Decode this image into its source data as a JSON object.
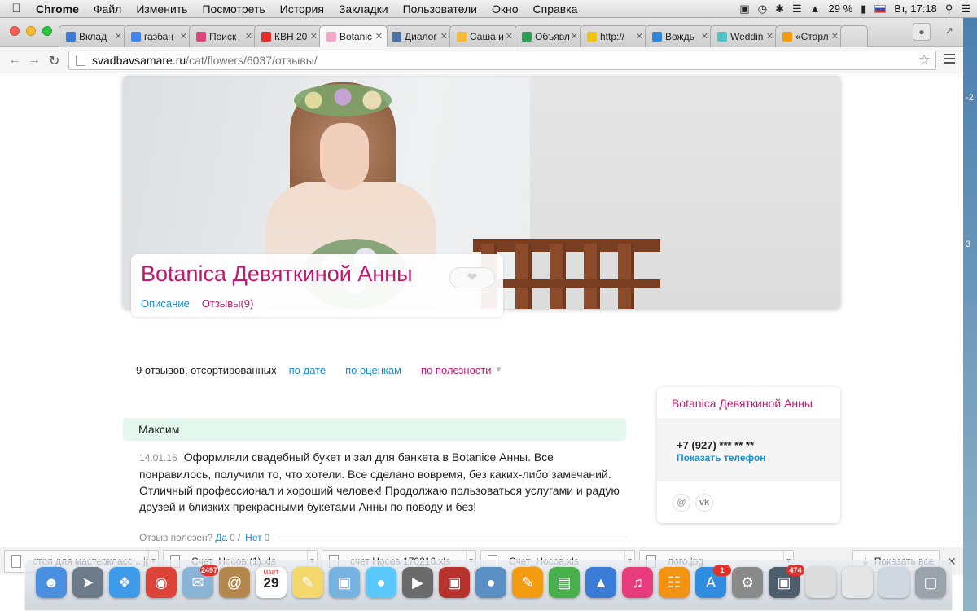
{
  "menubar": {
    "app_name": "Chrome",
    "items": [
      "Файл",
      "Изменить",
      "Посмотреть",
      "История",
      "Закладки",
      "Пользователи",
      "Окно",
      "Справка"
    ],
    "battery": "29 %",
    "clock": "Вт, 17:18"
  },
  "tabs": [
    {
      "title": "Вклад",
      "color": "#3b7bd6",
      "active": false
    },
    {
      "title": "газбан",
      "color": "#4285f4",
      "active": false
    },
    {
      "title": "Поиск",
      "color": "#e0447a",
      "active": false
    },
    {
      "title": "КВН 20",
      "color": "#e52d27",
      "active": false
    },
    {
      "title": "Botanic",
      "color": "#f3a6c8",
      "active": true
    },
    {
      "title": "Диалог",
      "color": "#4c75a3",
      "active": false
    },
    {
      "title": "Саша и",
      "color": "#f6b93b",
      "active": false
    },
    {
      "title": "Объявл",
      "color": "#2e9e57",
      "active": false
    },
    {
      "title": "http://",
      "color": "#f1c40f",
      "active": false
    },
    {
      "title": "Вождь",
      "color": "#2e86de",
      "active": false
    },
    {
      "title": "Weddin",
      "color": "#4fc3c7",
      "active": false
    },
    {
      "title": "«Старл",
      "color": "#f39c12",
      "active": false
    }
  ],
  "address": {
    "host": "svadbavsamare.ru",
    "path": "/cat/flowers/6037/отзывы/"
  },
  "profile": {
    "title": "Botanica Девяткиной Анны",
    "tab_description": "Описание",
    "tab_reviews": "Отзывы(9)"
  },
  "sort": {
    "summary": "9 отзывов, отсортированных",
    "by_date": "по дате",
    "by_rating": "по оценкам",
    "by_usefulness": "по полезности"
  },
  "review": {
    "author": "Максим",
    "date": "14.01.16",
    "text": "Оформляли свадебный букет и зал для банкета в Botanice Анны. Все понравилось, получили то, что хотели. Все сделано вовремя, без каких-либо замечаний. Отличный профессионал и хороший человек! Продолжаю пользоваться услугами и радую друзей и близких прекрасными букетами Анны по поводу и без!",
    "useful_label": "Отзыв полезен?",
    "yes_label": "Да",
    "yes_count": "0",
    "separator": "/",
    "no_label": "Нет",
    "no_count": "0"
  },
  "sidebar": {
    "title": "Botanica Девяткиной Анны",
    "phone": "+7 (927) *** ** **",
    "show_phone": "Показать телефон",
    "email_icon": "@",
    "vk_icon": "vk"
  },
  "downloads": {
    "items": [
      "стол для мастеркласс....jpg",
      "Счет_Носов (1).xls",
      "счет Носов 170216.xls",
      "Счет_Носов.xls",
      "лого.jpg"
    ],
    "show_all": "Показать все"
  },
  "dock": {
    "badges": {
      "mail": "2497",
      "appstore": "1",
      "app": "474"
    },
    "calendar_month": "МАРТ",
    "calendar_day": "29"
  },
  "colors": {
    "accent_pink": "#c0186f",
    "link_blue": "#1a8ecf",
    "review_head_bg": "#e4f7ee"
  }
}
